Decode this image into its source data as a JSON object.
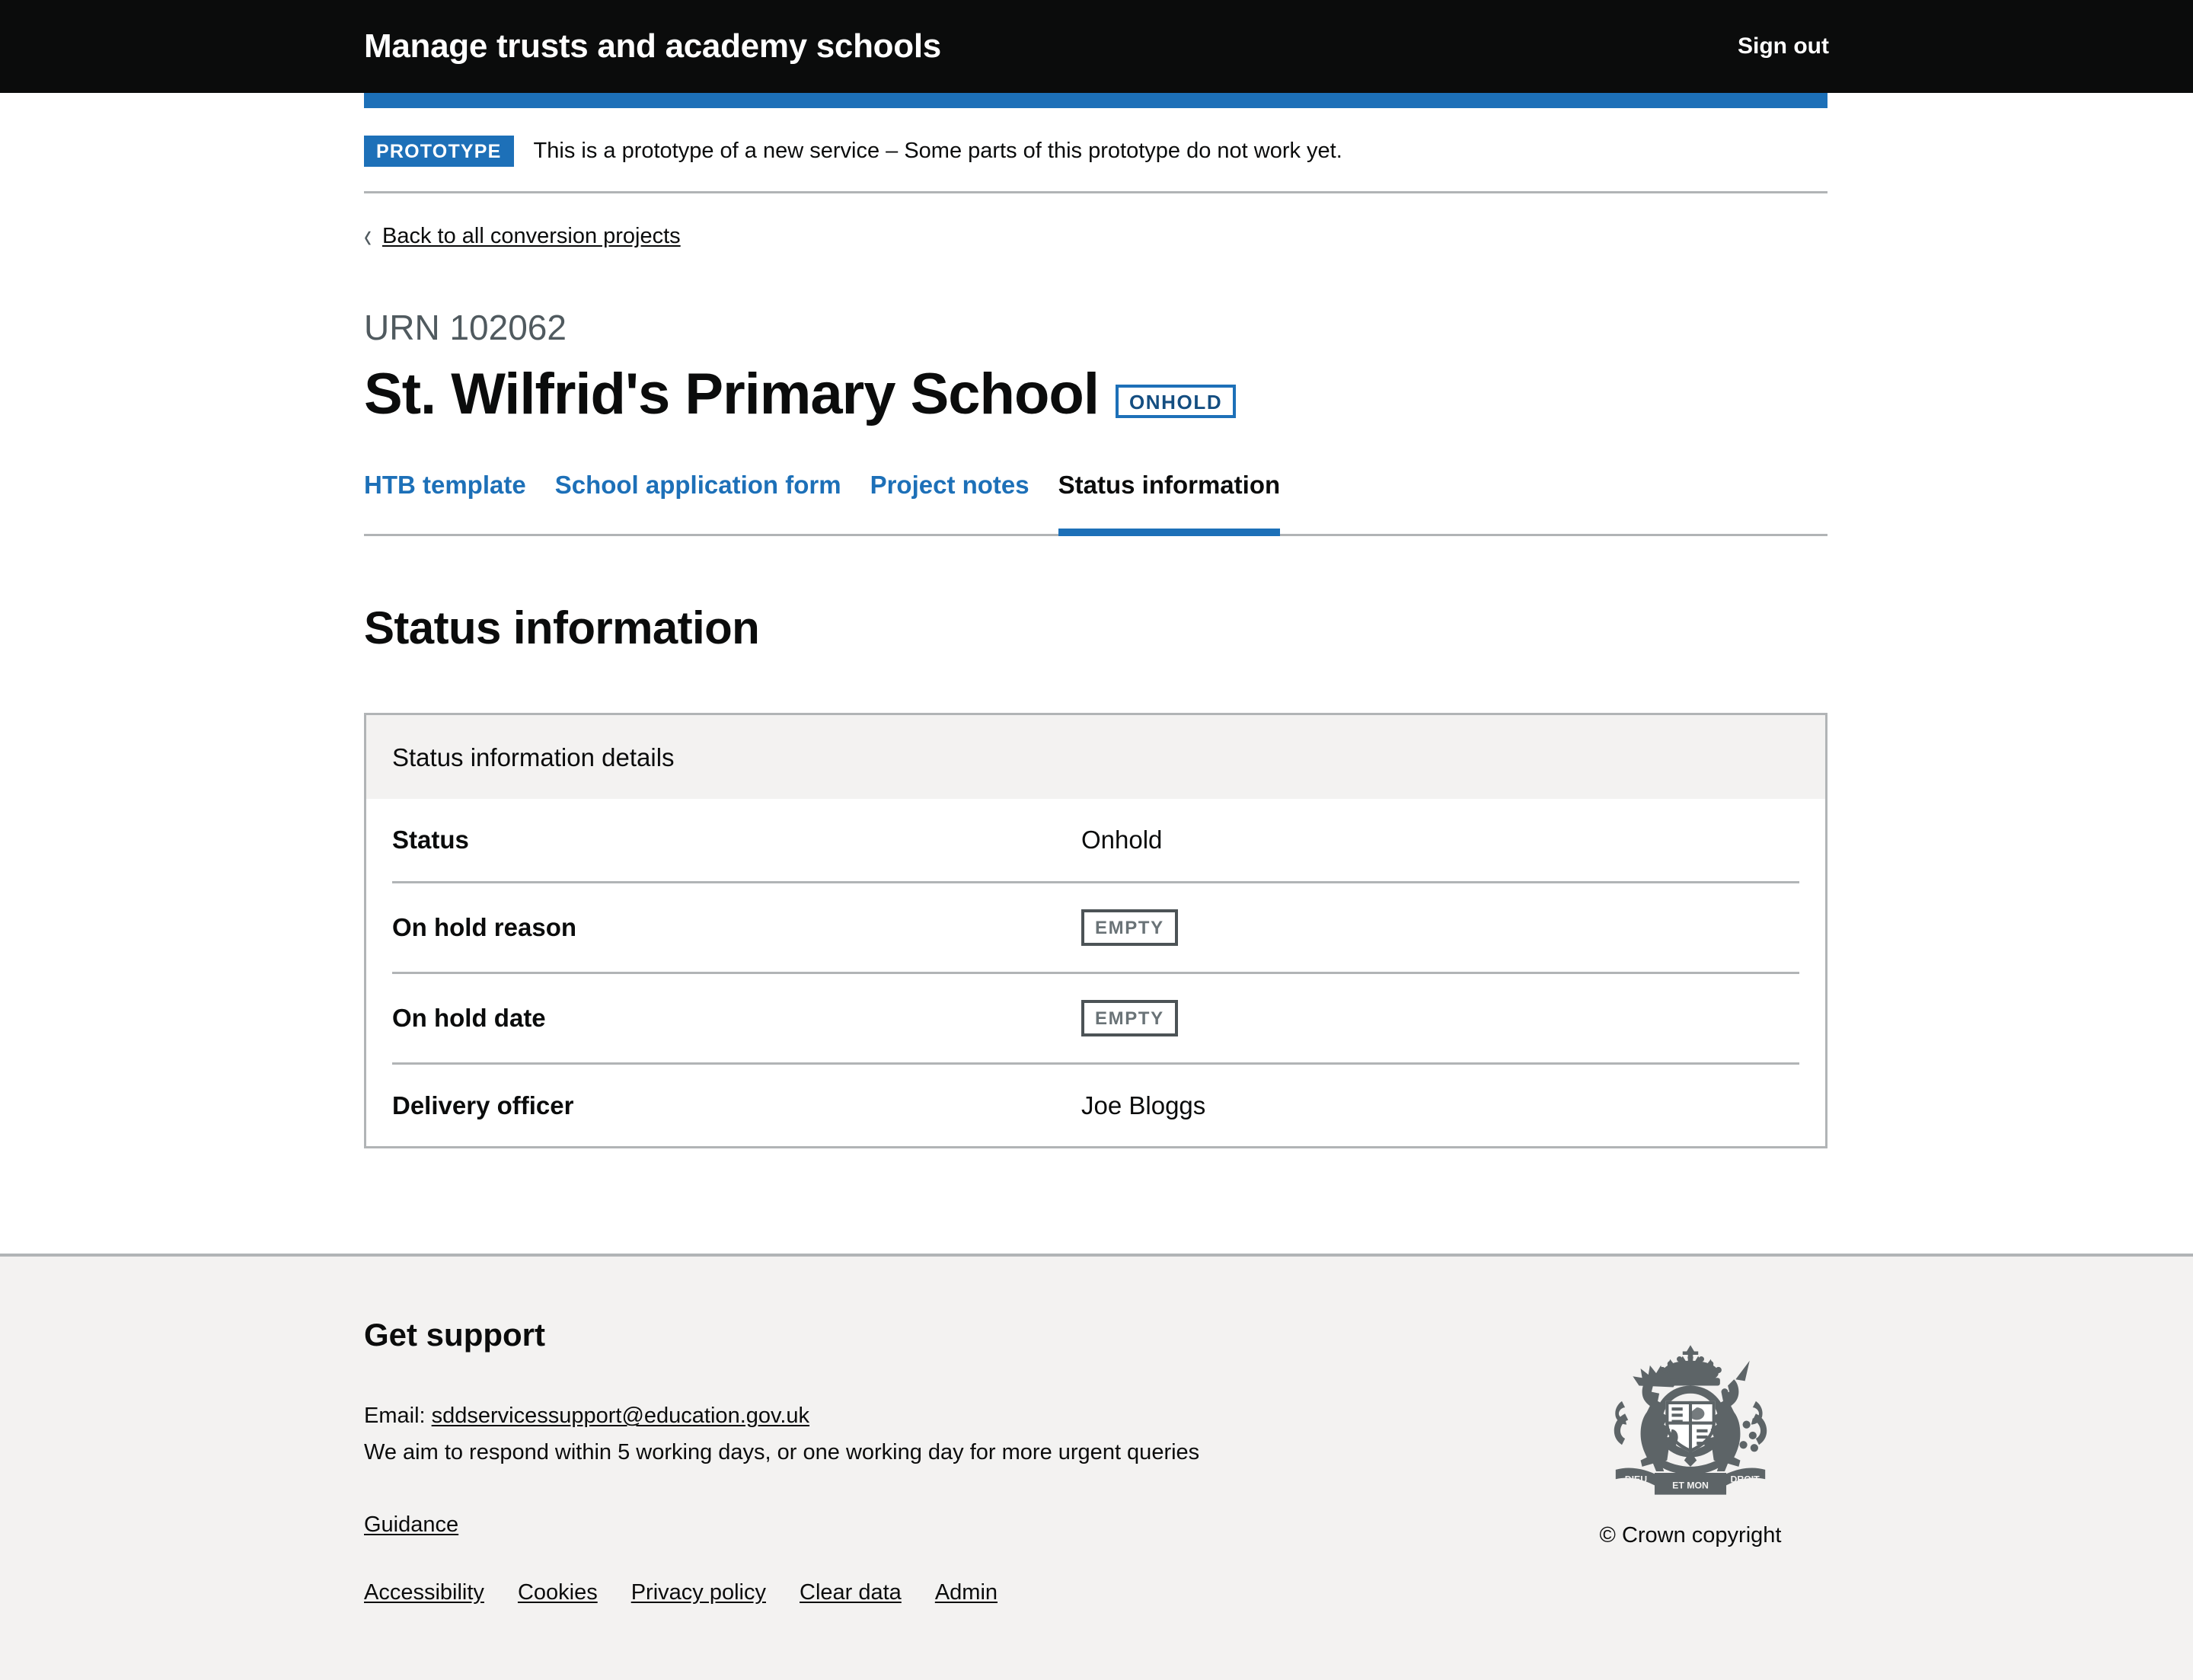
{
  "header": {
    "service_name": "Manage trusts and academy schools",
    "sign_out_label": "Sign out"
  },
  "phase_banner": {
    "tag": "PROTOTYPE",
    "text": "This is a prototype of a new service – Some parts of this prototype do not work yet."
  },
  "back_link": {
    "chevron": "‹",
    "label": "Back to all conversion projects"
  },
  "page": {
    "urn": "URN 102062",
    "title": "St. Wilfrid's Primary School",
    "status_tag": "ONHOLD",
    "section_heading": "Status information"
  },
  "tabs": [
    {
      "label": "HTB template",
      "active": false
    },
    {
      "label": "School application form",
      "active": false
    },
    {
      "label": "Project notes",
      "active": false
    },
    {
      "label": "Status information",
      "active": true
    }
  ],
  "card": {
    "header": "Status information details",
    "rows": [
      {
        "key": "Status",
        "value": "Onhold",
        "empty": false
      },
      {
        "key": "On hold reason",
        "value": "EMPTY",
        "empty": true
      },
      {
        "key": "On hold date",
        "value": "EMPTY",
        "empty": true
      },
      {
        "key": "Delivery officer",
        "value": "Joe Bloggs",
        "empty": false
      }
    ]
  },
  "footer": {
    "heading": "Get support",
    "email_prefix": "Email: ",
    "email": "sddservicessupport@education.gov.uk",
    "response_text": "We aim to respond within 5 working days, or one working day for more urgent queries",
    "guidance_label": "Guidance",
    "links": [
      {
        "label": "Accessibility"
      },
      {
        "label": "Cookies"
      },
      {
        "label": "Privacy policy"
      },
      {
        "label": "Clear data"
      },
      {
        "label": "Admin"
      }
    ],
    "crown_copyright": "© Crown copyright"
  },
  "colors": {
    "brand_blue": "#1d70b8",
    "black": "#0b0c0c",
    "grey_border": "#b1b4b6",
    "grey_bg": "#f3f2f1",
    "muted_text": "#505a5f",
    "tag_border_dark": "#4c5356"
  }
}
